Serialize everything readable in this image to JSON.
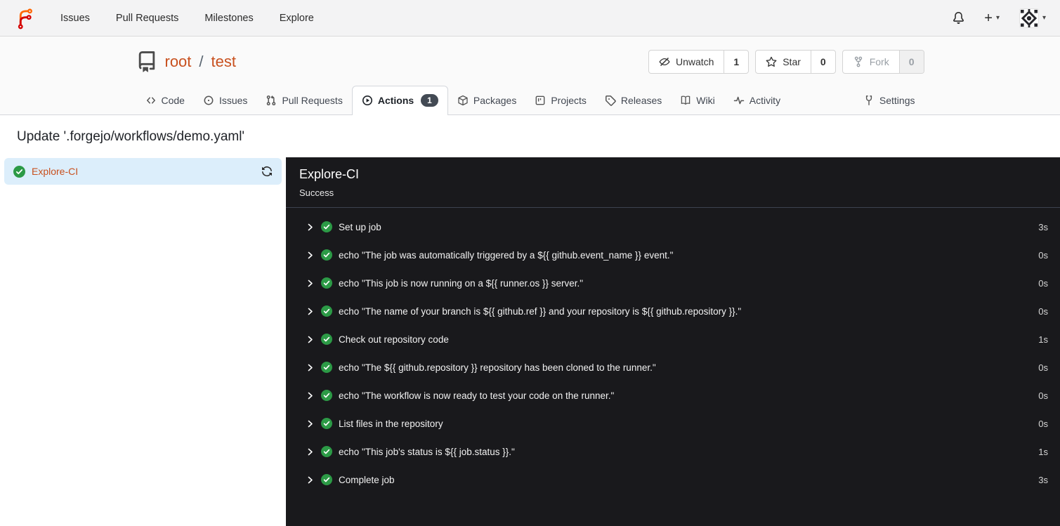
{
  "navbar": {
    "links": [
      {
        "label": "Issues"
      },
      {
        "label": "Pull Requests"
      },
      {
        "label": "Milestones"
      },
      {
        "label": "Explore"
      }
    ],
    "plus_label": "+",
    "caret": "▾"
  },
  "repo": {
    "owner": "root",
    "separator": "/",
    "name": "test",
    "actions": [
      {
        "label": "Unwatch",
        "count": "1"
      },
      {
        "label": "Star",
        "count": "0"
      },
      {
        "label": "Fork",
        "count": "0"
      }
    ]
  },
  "tabs": [
    {
      "label": "Code"
    },
    {
      "label": "Issues"
    },
    {
      "label": "Pull Requests"
    },
    {
      "label": "Actions",
      "badge": "1"
    },
    {
      "label": "Packages"
    },
    {
      "label": "Projects"
    },
    {
      "label": "Releases"
    },
    {
      "label": "Wiki"
    },
    {
      "label": "Activity"
    },
    {
      "label": "Settings"
    }
  ],
  "page": {
    "title": "Update '.forgejo/workflows/demo.yaml'"
  },
  "sidebar": {
    "job": {
      "name": "Explore-CI"
    }
  },
  "job_panel": {
    "title": "Explore-CI",
    "status": "Success",
    "steps": [
      {
        "name": "Set up job",
        "duration": "3s"
      },
      {
        "name": "echo \"The job was automatically triggered by a ${{ github.event_name }} event.\"",
        "duration": "0s"
      },
      {
        "name": "echo \"This job is now running on a ${{ runner.os }} server.\"",
        "duration": "0s"
      },
      {
        "name": "echo \"The name of your branch is ${{ github.ref }} and your repository is ${{ github.repository }}.\"",
        "duration": "0s"
      },
      {
        "name": "Check out repository code",
        "duration": "1s"
      },
      {
        "name": "echo \"The ${{ github.repository }} repository has been cloned to the runner.\"",
        "duration": "0s"
      },
      {
        "name": "echo \"The workflow is now ready to test your code on the runner.\"",
        "duration": "0s"
      },
      {
        "name": "List files in the repository",
        "duration": "0s"
      },
      {
        "name": "echo \"This job's status is ${{ job.status }}.\"",
        "duration": "1s"
      },
      {
        "name": "Complete job",
        "duration": "3s"
      }
    ]
  },
  "colors": {
    "accent_link": "#c8501e",
    "success_green": "#2c9a46",
    "log_panel_bg": "#19191c",
    "sidebar_selected_bg": "#dceefb",
    "tab_badge_bg": "#434a54",
    "navbar_bg": "#f3f3f4",
    "logo_orange": "#ff6600",
    "logo_red": "#d40000"
  }
}
